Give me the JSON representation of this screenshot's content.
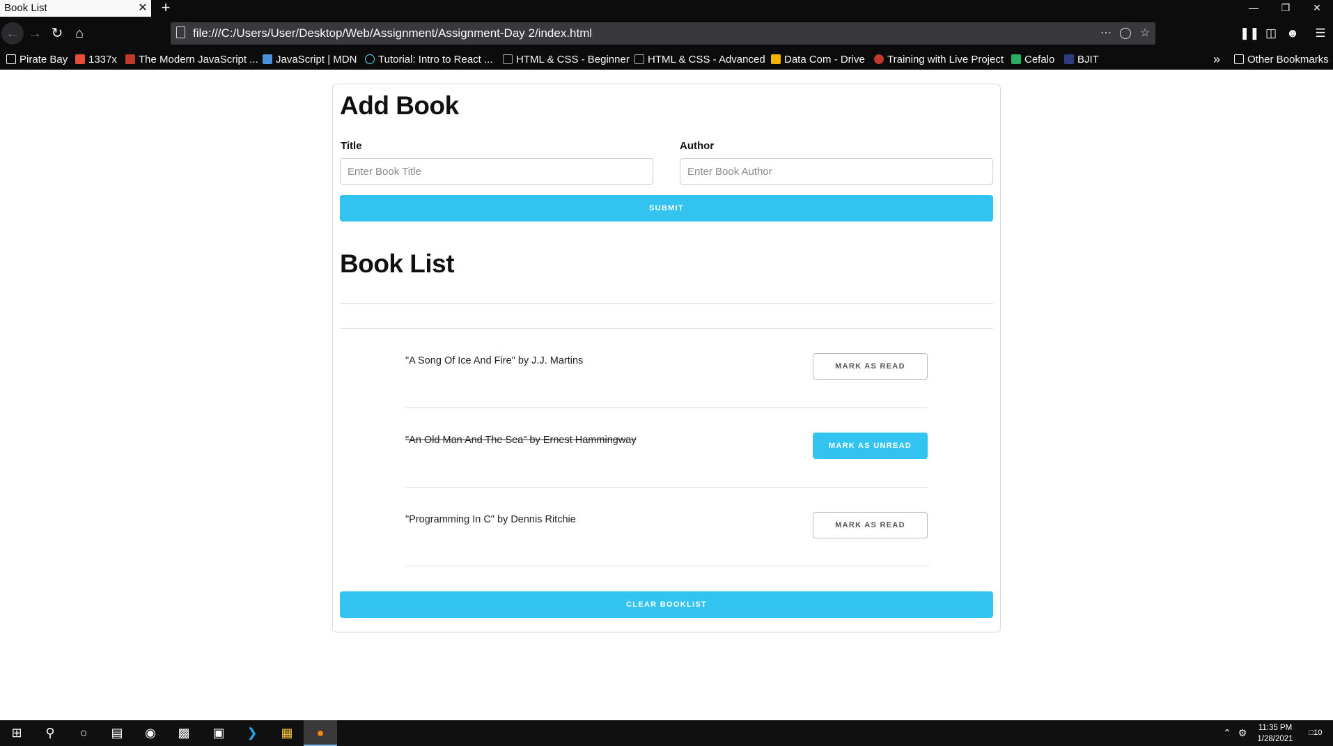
{
  "browser": {
    "tab_title": "Book List",
    "tab_close": "✕",
    "new_tab": "+",
    "url": "file:///C:/Users/User/Desktop/Web/Assignment/Assignment-Day 2/index.html",
    "bookmarks": [
      {
        "label": "Pirate Bay",
        "icon_color": "#f9f9fa"
      },
      {
        "label": "1337x",
        "icon_color": "#e74c3c"
      },
      {
        "label": "The Modern JavaScript ...",
        "icon_color": "#c0392b"
      },
      {
        "label": "JavaScript | MDN",
        "icon_color": "#4a90d9"
      },
      {
        "label": "Tutorial: Intro to React ...",
        "icon_color": "#61dafb"
      },
      {
        "label": "HTML & CSS - Beginner",
        "icon_color": "#aaaaaa"
      },
      {
        "label": "HTML & CSS - Advanced",
        "icon_color": "#aaaaaa"
      },
      {
        "label": "Data Com - Drive",
        "icon_color": "#f4b400"
      },
      {
        "label": "Training with Live Project",
        "icon_color": "#c0392b"
      },
      {
        "label": "Cefalo",
        "icon_color": "#27ae60"
      },
      {
        "label": "BJIT",
        "icon_color": "#2c3e80"
      }
    ],
    "overflow": "»",
    "other_bookmarks": "Other Bookmarks"
  },
  "form": {
    "heading": "Add Book",
    "title_label": "Title",
    "title_placeholder": "Enter Book Title",
    "author_label": "Author",
    "author_placeholder": "Enter Book Author",
    "submit_label": "SUBMIT"
  },
  "list": {
    "heading": "Book List",
    "books": [
      {
        "text": "\"A Song Of Ice And Fire\" by J.J. Martins",
        "read": false,
        "button": "MARK AS READ"
      },
      {
        "text": "\"An Old Man And The Sea\" by Ernest Hammingway",
        "read": true,
        "button": "MARK AS UNREAD"
      },
      {
        "text": "\"Programming In C\" by Dennis Ritchie",
        "read": false,
        "button": "MARK AS READ"
      }
    ],
    "clear_label": "CLEAR BOOKLIST"
  },
  "taskbar": {
    "time": "11:35 PM",
    "date": "1/28/2021",
    "notifications": "10"
  },
  "colors": {
    "accent": "#33c3f0",
    "chrome_bg": "#0c0c0d"
  }
}
